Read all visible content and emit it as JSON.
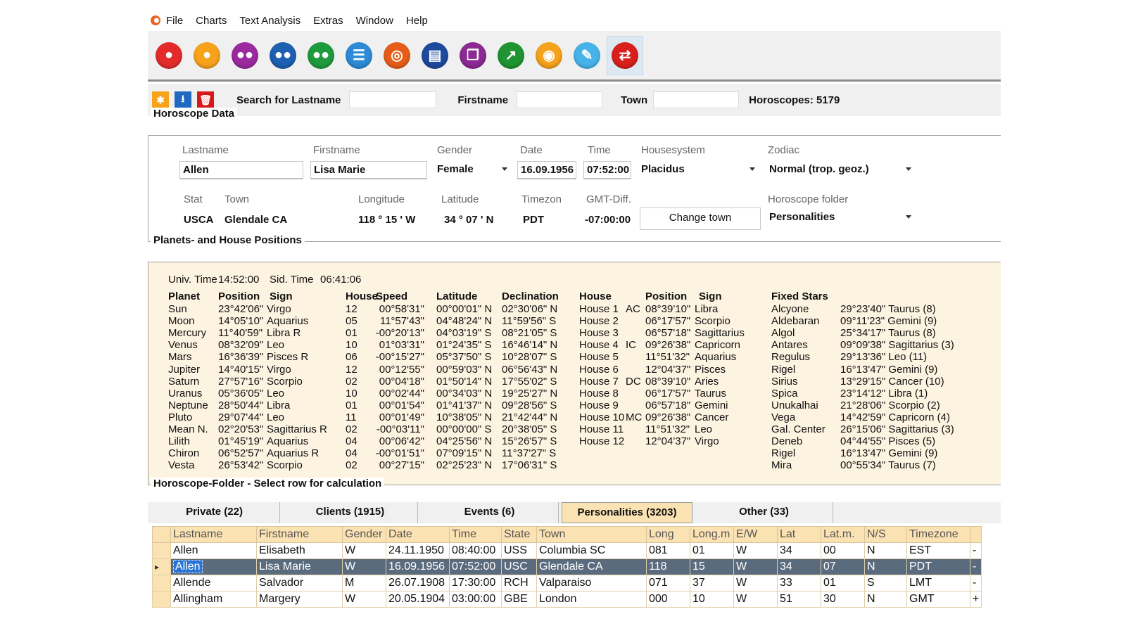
{
  "menu": [
    "File",
    "Charts",
    "Text Analysis",
    "Extras",
    "Window",
    "Help"
  ],
  "toolbar": {
    "icons": [
      {
        "name": "person-icon",
        "color": "#e32b2b",
        "glyph": "●"
      },
      {
        "name": "person-orange-icon",
        "color": "#f7a21b",
        "glyph": "●"
      },
      {
        "name": "couple-icon",
        "color": "#9b2a9e",
        "glyph": "●●"
      },
      {
        "name": "group-blue-icon",
        "color": "#1d5fb0",
        "glyph": "●●"
      },
      {
        "name": "group-green-icon",
        "color": "#1f9a3c",
        "glyph": "●●"
      },
      {
        "name": "list-icon",
        "color": "#2c8ad6",
        "glyph": "☰"
      },
      {
        "name": "globe-icon",
        "color": "#e65d1a",
        "glyph": "◎"
      },
      {
        "name": "card-icon",
        "color": "#1d4a9c",
        "glyph": "▤"
      },
      {
        "name": "book-icon",
        "color": "#8b2a93",
        "glyph": "❐"
      },
      {
        "name": "trend-chart-icon",
        "color": "#1f9431",
        "glyph": "↗"
      },
      {
        "name": "podcast-icon",
        "color": "#f5a21c",
        "glyph": "◉"
      },
      {
        "name": "edit-icon",
        "color": "#47b3e8",
        "glyph": "✎"
      },
      {
        "name": "swap-icon",
        "color": "#d9201c",
        "glyph": "⇄"
      }
    ]
  },
  "search": {
    "lastname_label": "Search for Lastname",
    "firstname_label": "Firstname",
    "town_label": "Town",
    "count": "Horoscopes: 5179",
    "lastname_value": "",
    "firstname_value": "",
    "town_value": ""
  },
  "horoscope_data": {
    "title": "Horoscope Data",
    "labels": {
      "lastname": "Lastname",
      "firstname": "Firstname",
      "gender": "Gender",
      "date": "Date",
      "time": "Time",
      "housesystem": "Housesystem",
      "zodiac": "Zodiac",
      "stat": "Stat",
      "town": "Town",
      "longitude": "Longitude",
      "latitude": "Latitude",
      "timezone": "Timezon",
      "gmt": "GMT-Diff.",
      "folder": "Horoscope folder"
    },
    "lastname": "Allen",
    "firstname": "Lisa Marie",
    "gender": "Female",
    "date": "16.09.1956",
    "time": "07:52:00",
    "housesystem": "Placidus",
    "zodiac": "Normal (trop. geoz.)",
    "stat": "USCA",
    "town": "Glendale CA",
    "longitude": "118 ° 15 ' W",
    "latitude": "34 ° 07 ' N",
    "timezone": "PDT",
    "gmt": "-07:00:00",
    "change_town": "Change town",
    "folder": "Personalities"
  },
  "positions": {
    "title": "Planets- and House Positions",
    "univ_time_label": "Univ. Time",
    "univ_time": "14:52:00",
    "sid_time_label": "Sid. Time",
    "sid_time": "06:41:06",
    "headers": {
      "planet": "Planet",
      "position": "Position",
      "sign": "Sign",
      "house": "House",
      "speed": "Speed",
      "latitude": "Latitude",
      "declination": "Declination",
      "house2": "House",
      "position2": "Position",
      "sign2": "Sign",
      "fixed": "Fixed Stars"
    },
    "planets": [
      [
        "Sun",
        "23°42'06\"",
        "Virgo",
        "12",
        "00°58'31\"",
        "00°00'01\" N",
        "02°30'06\" N"
      ],
      [
        "Moon",
        "14°05'10\"",
        "Aquarius",
        "05",
        "11°57'43\"",
        "04°48'24\" N",
        "11°59'56\" S"
      ],
      [
        "Mercury",
        "11°40'59\"",
        "Libra R",
        "01",
        "-00°20'13\"",
        "04°03'19\" S",
        "08°21'05\" S"
      ],
      [
        "Venus",
        "08°32'09\"",
        "Leo",
        "10",
        "01°03'31\"",
        "01°24'35\" S",
        "16°46'14\" N"
      ],
      [
        "Mars",
        "16°36'39\"",
        "Pisces R",
        "06",
        "-00°15'27\"",
        "05°37'50\" S",
        "10°28'07\" S"
      ],
      [
        "Jupiter",
        "14°40'15\"",
        "Virgo",
        "12",
        "00°12'55\"",
        "00°59'03\" N",
        "06°56'43\" N"
      ],
      [
        "Saturn",
        "27°57'16\"",
        "Scorpio",
        "02",
        "00°04'18\"",
        "01°50'14\" N",
        "17°55'02\" S"
      ],
      [
        "Uranus",
        "05°36'05\"",
        "Leo",
        "10",
        "00°02'44\"",
        "00°34'03\" N",
        "19°25'27\" N"
      ],
      [
        "Neptune",
        "28°50'44\"",
        "Libra",
        "01",
        "00°01'54\"",
        "01°41'37\" N",
        "09°28'56\" S"
      ],
      [
        "Pluto",
        "29°07'44\"",
        "Leo",
        "11",
        "00°01'49\"",
        "10°38'05\" N",
        "21°42'44\" N"
      ],
      [
        "Mean N.",
        "02°20'53\"",
        "Sagittarius R",
        "02",
        "-00°03'11\"",
        "00°00'00\" S",
        "20°38'05\" S"
      ],
      [
        "Lilith",
        "01°45'19\"",
        "Aquarius",
        "04",
        "00°06'42\"",
        "04°25'56\" N",
        "15°26'57\" S"
      ],
      [
        "Chiron",
        "06°52'57\"",
        "Aquarius R",
        "04",
        "-00°01'51\"",
        "07°09'15\" N",
        "11°37'27\" S"
      ],
      [
        "Vesta",
        "26°53'42\"",
        "Scorpio",
        "02",
        "00°27'15\"",
        "02°25'23\" N",
        "17°06'31\" S"
      ]
    ],
    "houses": [
      [
        "House 1",
        "AC",
        "08°39'10\"",
        "Libra"
      ],
      [
        "House 2",
        "",
        "06°17'57\"",
        "Scorpio"
      ],
      [
        "House 3",
        "",
        "06°57'18\"",
        "Sagittarius"
      ],
      [
        "House 4",
        "IC",
        "09°26'38\"",
        "Capricorn"
      ],
      [
        "House 5",
        "",
        "11°51'32\"",
        "Aquarius"
      ],
      [
        "House 6",
        "",
        "12°04'37\"",
        "Pisces"
      ],
      [
        "House 7",
        "DC",
        "08°39'10\"",
        "Aries"
      ],
      [
        "House 8",
        "",
        "06°17'57\"",
        "Taurus"
      ],
      [
        "House 9",
        "",
        "06°57'18\"",
        "Gemini"
      ],
      [
        "House 10",
        "MC",
        "09°26'38\"",
        "Cancer"
      ],
      [
        "House 11",
        "",
        "11°51'32\"",
        "Leo"
      ],
      [
        "House 12",
        "",
        "12°04'37\"",
        "Virgo"
      ]
    ],
    "fixed_stars": [
      [
        "Alcyone",
        "29°23'40\" Taurus (8)"
      ],
      [
        "Aldebaran",
        "09°11'23\" Gemini (9)"
      ],
      [
        "Algol",
        "25°34'17\" Taurus (8)"
      ],
      [
        "Antares",
        "09°09'38\" Sagittarius (3)"
      ],
      [
        "Regulus",
        "29°13'36\" Leo (11)"
      ],
      [
        "Rigel",
        "16°13'47\" Gemini (9)"
      ],
      [
        "Sirius",
        "13°29'15\" Cancer (10)"
      ],
      [
        "Spica",
        "23°14'12\" Libra (1)"
      ],
      [
        "Unukalhai",
        "21°28'06\" Scorpio (2)"
      ],
      [
        "Vega",
        "14°42'59\" Capricorn (4)"
      ],
      [
        "Gal. Center",
        "26°15'06\" Sagittarius (3)"
      ],
      [
        "Deneb",
        "04°44'55\" Pisces (5)"
      ],
      [
        "Rigel",
        "16°13'47\" Gemini (9)"
      ],
      [
        "Mira",
        "00°55'34\" Taurus (7)"
      ]
    ]
  },
  "folder": {
    "title": "Horoscope-Folder - Select row for calculation",
    "tabs": [
      {
        "label": "Private (22)"
      },
      {
        "label": "Clients (1915)"
      },
      {
        "label": "Events (6)"
      },
      {
        "label": "Personalities (3203)",
        "active": true
      },
      {
        "label": "Other (33)"
      }
    ],
    "columns": [
      "Lastname",
      "Firstname",
      "Gender",
      "Date",
      "Time",
      "State",
      "Town",
      "Long",
      "Long.m",
      "E/W",
      "Lat",
      "Lat.m.",
      "N/S",
      "Timezone",
      ""
    ],
    "rows": [
      [
        "Allen",
        "Elisabeth",
        "W",
        "24.11.1950",
        "08:40:00",
        "USS",
        "Columbia SC",
        "081",
        "01",
        "W",
        "34",
        "00",
        "N",
        "EST",
        "-"
      ],
      [
        "Allen",
        "Lisa Marie",
        "W",
        "16.09.1956",
        "07:52:00",
        "USC",
        "Glendale CA",
        "118",
        "15",
        "W",
        "34",
        "07",
        "N",
        "PDT",
        "-"
      ],
      [
        "Allende",
        "Salvador",
        "M",
        "26.07.1908",
        "17:30:00",
        "RCH",
        "Valparaiso",
        "071",
        "37",
        "W",
        "33",
        "01",
        "S",
        "LMT",
        "-"
      ],
      [
        "Allingham",
        "Margery",
        "W",
        "20.05.1904",
        "03:00:00",
        "GBE",
        "London",
        "000",
        "10",
        "W",
        "51",
        "30",
        "N",
        "GMT",
        "+"
      ]
    ],
    "selected_row": 1
  }
}
